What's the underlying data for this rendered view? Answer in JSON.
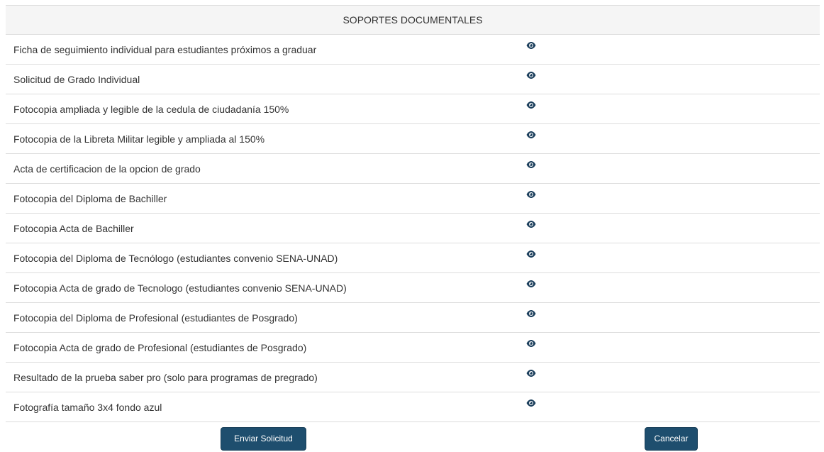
{
  "section": {
    "title": "SOPORTES DOCUMENTALES"
  },
  "documents": [
    {
      "name": "Ficha de seguimiento individual para estudiantes próximos a graduar",
      "action_icon": "eye-icon"
    },
    {
      "name": "Solicitud de Grado Individual",
      "action_icon": "eye-icon"
    },
    {
      "name": "Fotocopia ampliada y legible de la cedula de ciudadanía 150%",
      "action_icon": "eye-icon"
    },
    {
      "name": "Fotocopia de la Libreta Militar legible y ampliada al 150%",
      "action_icon": "eye-icon"
    },
    {
      "name": "Acta de certificacion de la opcion de grado",
      "action_icon": "eye-icon"
    },
    {
      "name": "Fotocopia del Diploma de Bachiller",
      "action_icon": "eye-icon"
    },
    {
      "name": "Fotocopia Acta de Bachiller",
      "action_icon": "eye-icon"
    },
    {
      "name": "Fotocopia del Diploma de Tecnólogo (estudiantes convenio SENA-UNAD)",
      "action_icon": "eye-icon"
    },
    {
      "name": "Fotocopia Acta de grado de Tecnologo (estudiantes convenio SENA-UNAD)",
      "action_icon": "eye-icon"
    },
    {
      "name": "Fotocopia del Diploma de Profesional (estudiantes de Posgrado)",
      "action_icon": "eye-icon"
    },
    {
      "name": "Fotocopia Acta de grado de Profesional (estudiantes de Posgrado)",
      "action_icon": "eye-icon"
    },
    {
      "name": "Resultado de la prueba saber pro (solo para programas de pregrado)",
      "action_icon": "eye-icon"
    },
    {
      "name": "Fotografía tamaño 3x4 fondo azul",
      "action_icon": "eye-icon"
    }
  ],
  "actions": {
    "submit_label": "Enviar Solicitud",
    "cancel_label": "Cancelar"
  },
  "colors": {
    "header_bg": "#f5f5f5",
    "row_border": "#dddddd",
    "button_bg": "#1e4e6e",
    "icon_color": "#1c3f5c",
    "text": "#333333"
  }
}
